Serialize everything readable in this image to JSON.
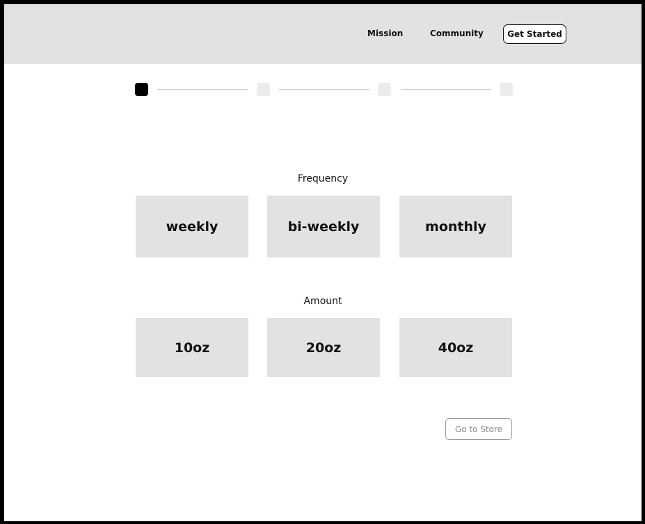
{
  "header": {
    "nav": {
      "mission": "Mission",
      "community": "Community",
      "get_started": "Get Started"
    }
  },
  "stepper": {
    "total_steps": 4,
    "current_step": 1
  },
  "frequency": {
    "label": "Frequency",
    "options": [
      "weekly",
      "bi-weekly",
      "monthly"
    ]
  },
  "amount": {
    "label": "Amount",
    "options": [
      "10oz",
      "20oz",
      "40oz"
    ]
  },
  "footer": {
    "store_button": "Go to Store"
  },
  "colors": {
    "header_bg": "#e2e2e2",
    "tile_bg": "#e2e2e2",
    "active_step": "#000000",
    "inactive_step": "#ececec"
  }
}
